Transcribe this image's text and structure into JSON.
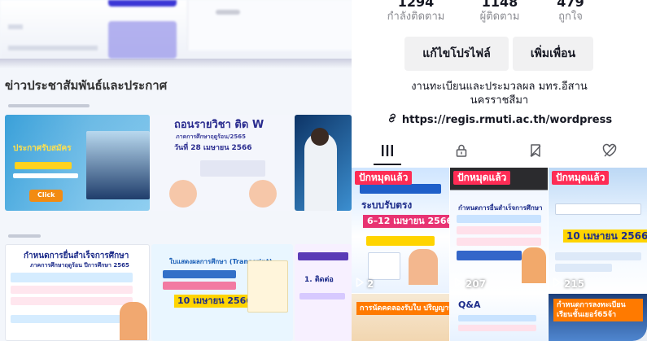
{
  "site": {
    "heading": "ข่าวประชาสัมพันธ์และประกาศ",
    "tiles": [
      {
        "line1": "ประกาศรับสมัคร",
        "line2": "Click"
      },
      {
        "line1": "ถอนรายวิชา ติด W",
        "line2": "ภาคการศึกษาฤดูร้อน/2565",
        "line3": "วันที่ 28 เมษายน 2566"
      },
      {
        "line1": ""
      },
      {
        "line1": "กำหนดการยื่นสำเร็จการศึกษา",
        "line2": "ภาคการศึกษาฤดูร้อน ปีการศึกษา 2565"
      },
      {
        "line1": "ใบแสดงผลการศึกษา (Transcript)",
        "line2": "10 เมษายน 2566"
      },
      {
        "line1": "1. ติดต่อ"
      }
    ]
  },
  "profile": {
    "stats": [
      {
        "value": "1294",
        "label": "กำลังติดตาม"
      },
      {
        "value": "1148",
        "label": "ผู้ติดตาม"
      },
      {
        "value": "479",
        "label": "ถูกใจ"
      }
    ],
    "edit_button": "แก้ไขโปรไฟล์",
    "add_friend_button": "เพิ่มเพื่อน",
    "bio_line1": "งานทะเบียนและประมวลผล มทร.อีสาน",
    "bio_line2": "นครราชสีมา",
    "link": "https://regis.rmuti.ac.th/wordpress",
    "tabs": [
      {
        "name": "videos",
        "icon": "grid-icon"
      },
      {
        "name": "private",
        "icon": "lock-icon"
      },
      {
        "name": "favorites",
        "icon": "bookmark-icon"
      },
      {
        "name": "liked",
        "icon": "heart-icon"
      }
    ],
    "videos": [
      {
        "pin": "ปักหมุดแล้ว",
        "views": "2",
        "caption": "ระบบรับตรง",
        "date": "6–12 เมษายน 2566"
      },
      {
        "pin": "ปักหมุดแล้ว",
        "views": "207",
        "caption": "กำหนดการยื่นสำเร็จการศึกษา"
      },
      {
        "pin": "ปักหมุดแล้ว",
        "views": "215",
        "caption": "10 เมษายน 2566"
      },
      {
        "caption": "การนัดคดลองรับใบ ปริญญาบัตร"
      },
      {
        "caption": "Q&A"
      },
      {
        "caption": "กำหนดการลงทะเบียน เรียนชั้นเยอร์65จ้า"
      }
    ]
  },
  "colors": {
    "accent": "#fe2c55",
    "brand_blue": "#3b36d6",
    "text": "#161823",
    "muted": "#8a8b91"
  }
}
